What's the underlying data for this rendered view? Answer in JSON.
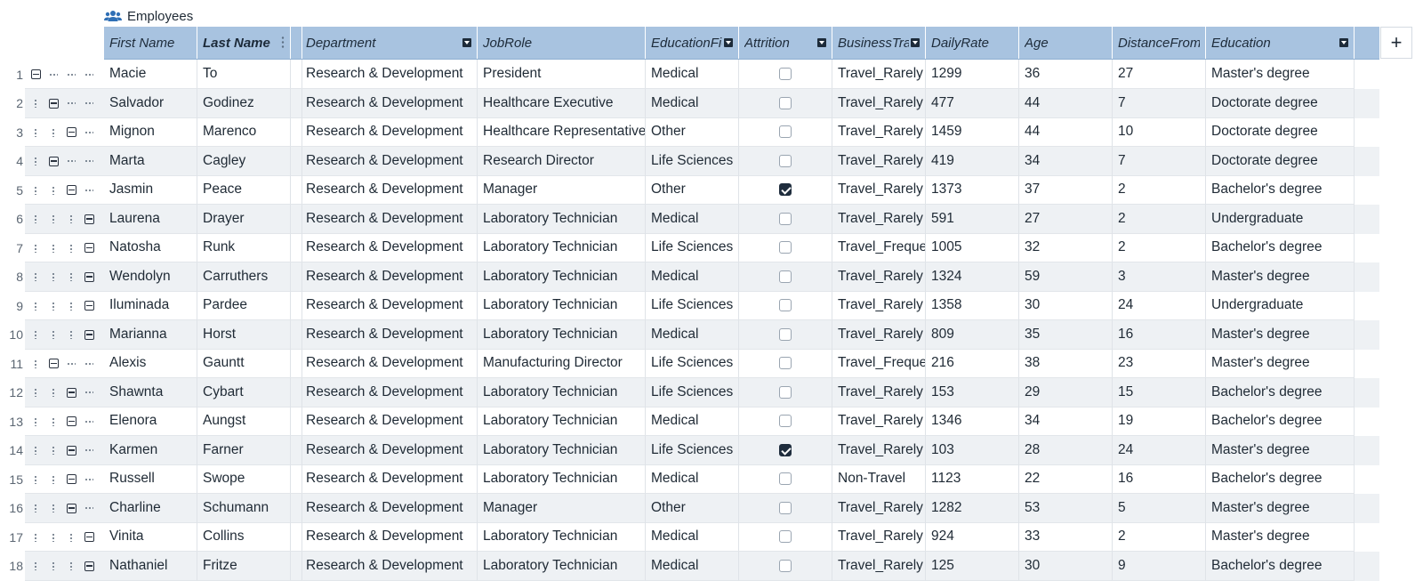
{
  "title": "Employees",
  "add_column_label": "+",
  "columns": [
    {
      "key": "first_name",
      "label": "First Name",
      "bold": false,
      "filter": false,
      "drag": false
    },
    {
      "key": "last_name",
      "label": "Last Name",
      "bold": true,
      "filter": false,
      "drag": true
    },
    {
      "key": "spacer",
      "label": "",
      "bold": false,
      "filter": false,
      "drag": false
    },
    {
      "key": "department",
      "label": "Department",
      "bold": false,
      "filter": true,
      "drag": false
    },
    {
      "key": "jobrole",
      "label": "JobRole",
      "bold": false,
      "filter": false,
      "drag": false
    },
    {
      "key": "educationfield",
      "label": "EducationFie",
      "bold": false,
      "filter": true,
      "drag": false
    },
    {
      "key": "attrition",
      "label": "Attrition",
      "bold": false,
      "filter": true,
      "drag": false
    },
    {
      "key": "businesstravel",
      "label": "BusinessTrav",
      "bold": false,
      "filter": true,
      "drag": false
    },
    {
      "key": "dailyrate",
      "label": "DailyRate",
      "bold": false,
      "filter": false,
      "drag": false
    },
    {
      "key": "age",
      "label": "Age",
      "bold": false,
      "filter": false,
      "drag": false
    },
    {
      "key": "distance",
      "label": "DistanceFromH",
      "bold": false,
      "filter": false,
      "drag": false
    },
    {
      "key": "education",
      "label": "Education",
      "bold": false,
      "filter": true,
      "drag": false
    }
  ],
  "rows": [
    {
      "n": "1",
      "level": 0,
      "first": "Macie",
      "last": "To",
      "dept": "Research & Development",
      "job": "President",
      "field": "Medical",
      "attrition": false,
      "travel": "Travel_Rarely",
      "rate": "1299",
      "age": "36",
      "dist": "27",
      "edu": "Master's degree"
    },
    {
      "n": "2",
      "level": 1,
      "first": "Salvador",
      "last": "Godinez",
      "dept": "Research & Development",
      "job": "Healthcare Executive",
      "field": "Medical",
      "attrition": false,
      "travel": "Travel_Rarely",
      "rate": "477",
      "age": "44",
      "dist": "7",
      "edu": "Doctorate degree"
    },
    {
      "n": "3",
      "level": 2,
      "first": "Mignon",
      "last": "Marenco",
      "dept": "Research & Development",
      "job": "Healthcare Representative",
      "field": "Other",
      "attrition": false,
      "travel": "Travel_Rarely",
      "rate": "1459",
      "age": "44",
      "dist": "10",
      "edu": "Doctorate degree"
    },
    {
      "n": "4",
      "level": 1,
      "first": "Marta",
      "last": "Cagley",
      "dept": "Research & Development",
      "job": "Research Director",
      "field": "Life Sciences",
      "attrition": false,
      "travel": "Travel_Rarely",
      "rate": "419",
      "age": "34",
      "dist": "7",
      "edu": "Doctorate degree"
    },
    {
      "n": "5",
      "level": 2,
      "first": "Jasmin",
      "last": "Peace",
      "dept": "Research & Development",
      "job": "Manager",
      "field": "Other",
      "attrition": true,
      "travel": "Travel_Rarely",
      "rate": "1373",
      "age": "37",
      "dist": "2",
      "edu": "Bachelor's degree"
    },
    {
      "n": "6",
      "level": 3,
      "first": "Laurena",
      "last": "Drayer",
      "dept": "Research & Development",
      "job": "Laboratory Technician",
      "field": "Medical",
      "attrition": false,
      "travel": "Travel_Rarely",
      "rate": "591",
      "age": "27",
      "dist": "2",
      "edu": "Undergraduate"
    },
    {
      "n": "7",
      "level": 3,
      "first": "Natosha",
      "last": "Runk",
      "dept": "Research & Development",
      "job": "Laboratory Technician",
      "field": "Life Sciences",
      "attrition": false,
      "travel": "Travel_Freque",
      "rate": "1005",
      "age": "32",
      "dist": "2",
      "edu": "Bachelor's degree"
    },
    {
      "n": "8",
      "level": 3,
      "first": "Wendolyn",
      "last": "Carruthers",
      "dept": "Research & Development",
      "job": "Laboratory Technician",
      "field": "Medical",
      "attrition": false,
      "travel": "Travel_Rarely",
      "rate": "1324",
      "age": "59",
      "dist": "3",
      "edu": "Master's degree"
    },
    {
      "n": "9",
      "level": 3,
      "first": "Iluminada",
      "last": "Pardee",
      "dept": "Research & Development",
      "job": "Laboratory Technician",
      "field": "Life Sciences",
      "attrition": false,
      "travel": "Travel_Rarely",
      "rate": "1358",
      "age": "30",
      "dist": "24",
      "edu": "Undergraduate"
    },
    {
      "n": "10",
      "level": 3,
      "first": "Marianna",
      "last": "Horst",
      "dept": "Research & Development",
      "job": "Laboratory Technician",
      "field": "Medical",
      "attrition": false,
      "travel": "Travel_Rarely",
      "rate": "809",
      "age": "35",
      "dist": "16",
      "edu": "Master's degree"
    },
    {
      "n": "11",
      "level": 1,
      "first": "Alexis",
      "last": "Gauntt",
      "dept": "Research & Development",
      "job": "Manufacturing Director",
      "field": "Life Sciences",
      "attrition": false,
      "travel": "Travel_Freque",
      "rate": "216",
      "age": "38",
      "dist": "23",
      "edu": "Master's degree"
    },
    {
      "n": "12",
      "level": 2,
      "first": "Shawnta",
      "last": "Cybart",
      "dept": "Research & Development",
      "job": "Laboratory Technician",
      "field": "Life Sciences",
      "attrition": false,
      "travel": "Travel_Rarely",
      "rate": "153",
      "age": "29",
      "dist": "15",
      "edu": "Bachelor's degree"
    },
    {
      "n": "13",
      "level": 2,
      "first": "Elenora",
      "last": "Aungst",
      "dept": "Research & Development",
      "job": "Laboratory Technician",
      "field": "Medical",
      "attrition": false,
      "travel": "Travel_Rarely",
      "rate": "1346",
      "age": "34",
      "dist": "19",
      "edu": "Bachelor's degree"
    },
    {
      "n": "14",
      "level": 2,
      "first": "Karmen",
      "last": "Farner",
      "dept": "Research & Development",
      "job": "Laboratory Technician",
      "field": "Life Sciences",
      "attrition": true,
      "travel": "Travel_Rarely",
      "rate": "103",
      "age": "28",
      "dist": "24",
      "edu": "Master's degree"
    },
    {
      "n": "15",
      "level": 2,
      "first": "Russell",
      "last": "Swope",
      "dept": "Research & Development",
      "job": "Laboratory Technician",
      "field": "Medical",
      "attrition": false,
      "travel": "Non-Travel",
      "rate": "1123",
      "age": "22",
      "dist": "16",
      "edu": "Bachelor's degree"
    },
    {
      "n": "16",
      "level": 2,
      "first": "Charline",
      "last": "Schumann",
      "dept": "Research & Development",
      "job": "Manager",
      "field": "Other",
      "attrition": false,
      "travel": "Travel_Rarely",
      "rate": "1282",
      "age": "53",
      "dist": "5",
      "edu": "Master's degree"
    },
    {
      "n": "17",
      "level": 3,
      "first": "Vinita",
      "last": "Collins",
      "dept": "Research & Development",
      "job": "Laboratory Technician",
      "field": "Medical",
      "attrition": false,
      "travel": "Travel_Rarely",
      "rate": "924",
      "age": "33",
      "dist": "2",
      "edu": "Master's degree"
    },
    {
      "n": "18",
      "level": 3,
      "first": "Nathaniel",
      "last": "Fritze",
      "dept": "Research & Development",
      "job": "Laboratory Technician",
      "field": "Medical",
      "attrition": false,
      "travel": "Travel_Rarely",
      "rate": "125",
      "age": "30",
      "dist": "9",
      "edu": "Bachelor's degree"
    }
  ]
}
